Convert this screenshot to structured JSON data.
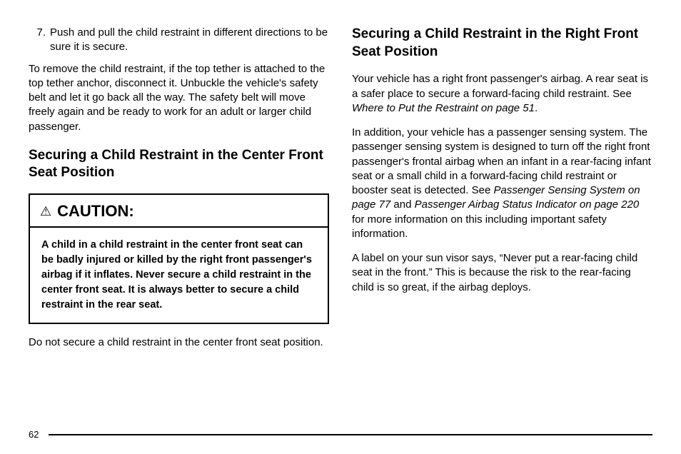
{
  "left": {
    "listItem": {
      "number": "7.",
      "text": "Push and pull the child restraint in different directions to be sure it is secure."
    },
    "removePara": "To remove the child restraint, if the top tether is attached to the top tether anchor, disconnect it. Unbuckle the vehicle's safety belt and let it go back all the way. The safety belt will move freely again and be ready to work for an adult or larger child passenger.",
    "heading1": "Securing a Child Restraint in the Center Front Seat Position",
    "caution": {
      "title": "CAUTION:",
      "body": "A child in a child restraint in the center front seat can be badly injured or killed by the right front passenger's airbag if it inflates. Never secure a child restraint in the center front seat. It is always better to secure a child restraint in the rear seat."
    },
    "afterCaution": "Do not secure a child restraint in the center front seat position."
  },
  "right": {
    "heading": "Securing a Child Restraint in the Right Front Seat Position",
    "p1a": "Your vehicle has a right front passenger's airbag. A rear seat is a safer place to secure a forward-facing child restraint. See ",
    "p1ref": "Where to Put the Restraint on page 51",
    "p1b": ".",
    "p2a": "In addition, your vehicle has a passenger sensing system. The passenger sensing system is designed to turn off the right front passenger's frontal airbag when an infant in a rear-facing infant seat or a small child in a forward-facing child restraint or booster seat is detected. See ",
    "p2ref1": "Passenger Sensing System on page 77",
    "p2mid": " and ",
    "p2ref2": "Passenger Airbag Status Indicator on page 220",
    "p2b": " for more information on this including important safety information.",
    "p3": "A label on your sun visor says, “Never put a rear-facing child seat in the front.” This is because the risk to the rear-facing child is so great, if the airbag deploys."
  },
  "pageNumber": "62"
}
